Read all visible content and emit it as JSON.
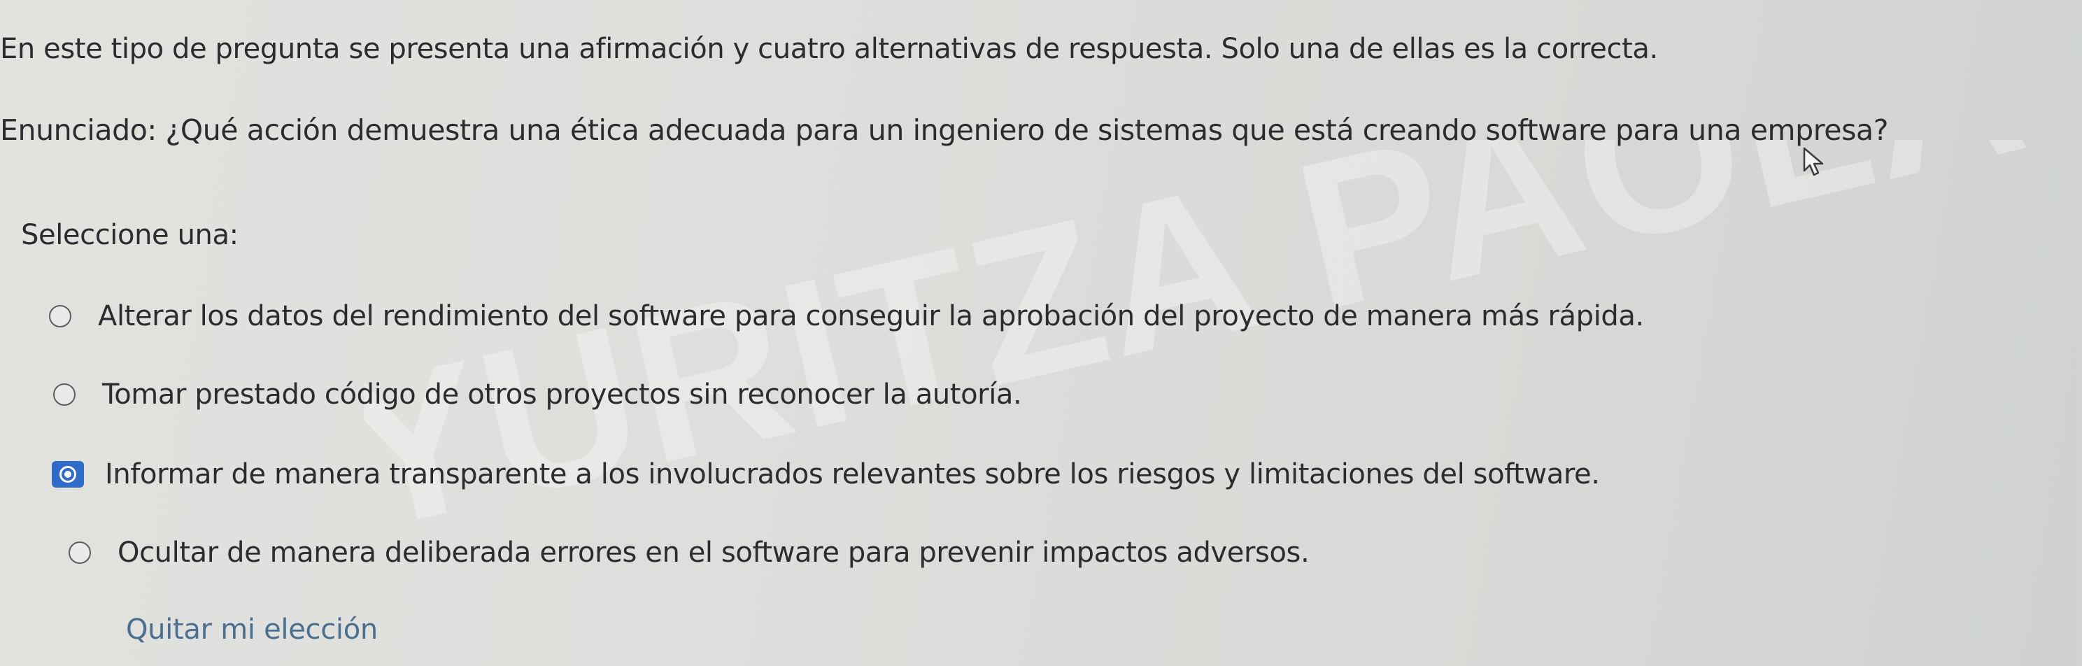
{
  "quiz": {
    "instructions": "En este tipo de pregunta se presenta una afirmación y cuatro alternativas de respuesta. Solo una de ellas es la correcta.",
    "question": "Enunciado: ¿Qué acción demuestra una ética adecuada para un ingeniero de sistemas que está creando software para una empresa?",
    "select_prompt": "Seleccione una:",
    "options": [
      {
        "label": "Alterar los datos del rendimiento del software para conseguir la aprobación del proyecto de manera más rápida.",
        "selected": false
      },
      {
        "label": "Tomar prestado código de otros proyectos sin reconocer la autoría.",
        "selected": false
      },
      {
        "label": "Informar de manera transparente a los involucrados relevantes sobre los riesgos y limitaciones del software.",
        "selected": true
      },
      {
        "label": "Ocultar de manera deliberada errores en el software para prevenir impactos adversos.",
        "selected": false
      }
    ],
    "clear_choice": "Quitar mi elección"
  },
  "watermark": {
    "text": "YURITZA PAOLA PORTACIO"
  },
  "colors": {
    "selected_radio": "#2f6bc9",
    "clear_link": "#4a6f8f",
    "text": "#2a2c30"
  }
}
